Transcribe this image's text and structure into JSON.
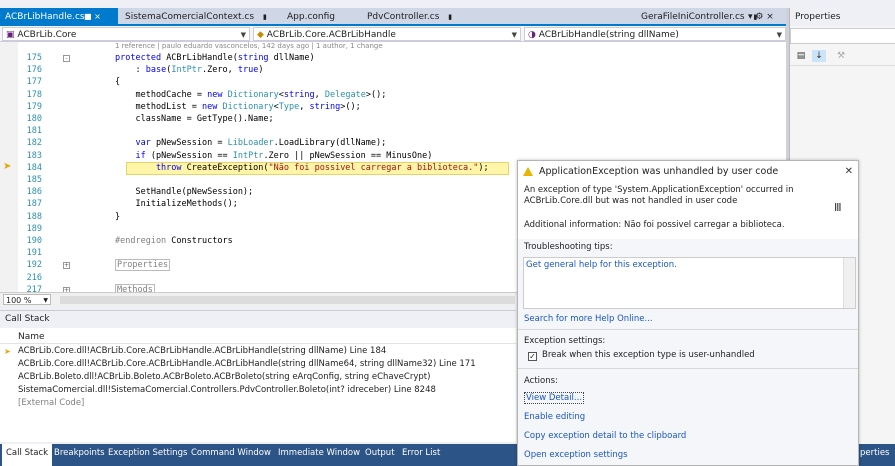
{
  "tabs": [
    {
      "label": "ACBrLibHandle.cs",
      "active": true,
      "controls": "■ ×"
    },
    {
      "label": "SistemaComercialContext.cs",
      "active": false
    },
    {
      "label": "App.config",
      "active": false
    },
    {
      "label": "PdvController.cs",
      "active": false
    },
    {
      "label": "GeraFileIniController.cs",
      "active": false
    }
  ],
  "tabbar_controls": "▾ ⚙ ×",
  "navbar": {
    "project": "ACBrLib.Core",
    "type": "ACBrLib.Core.ACBrLibHandle",
    "member": "ACBrLibHandle(string dllName)"
  },
  "code_lens": "1 reference | paulo eduardo vasconcelos, 142 days ago | 1 author, 1 change",
  "code": [
    {
      "ln": "175",
      "segs": [
        [
          "kw",
          "protected "
        ],
        [
          "",
          "ACBrLibHandle("
        ],
        [
          "kw",
          "string"
        ],
        [
          "",
          " dllName)"
        ]
      ]
    },
    {
      "ln": "176",
      "segs": [
        [
          "",
          "    : "
        ],
        [
          "kw",
          "base"
        ],
        [
          "",
          "("
        ],
        [
          "ty",
          "IntPtr"
        ],
        [
          "",
          ".Zero, "
        ],
        [
          "kw",
          "true"
        ],
        [
          "",
          ")"
        ]
      ]
    },
    {
      "ln": "177",
      "segs": [
        [
          "",
          "{"
        ]
      ]
    },
    {
      "ln": "178",
      "segs": [
        [
          "",
          "    methodCache = "
        ],
        [
          "kw",
          "new "
        ],
        [
          "ty",
          "Dictionary"
        ],
        [
          "",
          "<"
        ],
        [
          "kw",
          "string"
        ],
        [
          "",
          ", "
        ],
        [
          "ty",
          "Delegate"
        ],
        [
          "",
          ">();"
        ]
      ]
    },
    {
      "ln": "179",
      "segs": [
        [
          "",
          "    methodList = "
        ],
        [
          "kw",
          "new "
        ],
        [
          "ty",
          "Dictionary"
        ],
        [
          "",
          "<"
        ],
        [
          "ty",
          "Type"
        ],
        [
          "",
          ", "
        ],
        [
          "kw",
          "string"
        ],
        [
          "",
          ">();"
        ]
      ]
    },
    {
      "ln": "180",
      "segs": [
        [
          "",
          "    className = GetType().Name;"
        ]
      ]
    },
    {
      "ln": "181",
      "segs": [
        [
          "",
          ""
        ]
      ]
    },
    {
      "ln": "182",
      "segs": [
        [
          "kw",
          "    var "
        ],
        [
          "",
          "pNewSession = "
        ],
        [
          "ty",
          "LibLoader"
        ],
        [
          "",
          ".LoadLibrary(dllName);"
        ]
      ]
    },
    {
      "ln": "183",
      "segs": [
        [
          "kw",
          "    if "
        ],
        [
          "",
          "(pNewSession == "
        ],
        [
          "ty",
          "IntPtr"
        ],
        [
          "",
          ".Zero || pNewSession == MinusOne)"
        ]
      ]
    },
    {
      "ln": "184",
      "segs": [
        [
          "kw",
          "        throw "
        ],
        [
          "",
          "CreateException("
        ],
        [
          "st",
          "\"Não foi possivel carregar a biblioteca.\""
        ],
        [
          "",
          ");"
        ]
      ]
    },
    {
      "ln": "185",
      "segs": [
        [
          "",
          ""
        ]
      ]
    },
    {
      "ln": "186",
      "segs": [
        [
          "",
          "    SetHandle(pNewSession);"
        ]
      ]
    },
    {
      "ln": "187",
      "segs": [
        [
          "",
          "    InitializeMethods();"
        ]
      ]
    },
    {
      "ln": "188",
      "segs": [
        [
          "",
          "}"
        ]
      ]
    },
    {
      "ln": "189",
      "segs": [
        [
          "",
          ""
        ]
      ]
    },
    {
      "ln": "190",
      "segs": [
        [
          "gr",
          "#endregion "
        ],
        [
          "",
          "Constructors"
        ]
      ]
    },
    {
      "ln": "191",
      "segs": [
        [
          "",
          ""
        ]
      ]
    },
    {
      "ln": "192",
      "segs": [
        [
          "gr",
          "Properties"
        ]
      ]
    },
    {
      "ln": "216",
      "segs": [
        [
          "",
          ""
        ]
      ]
    },
    {
      "ln": "217",
      "segs": [
        [
          "gr",
          "Methods"
        ]
      ]
    }
  ],
  "zoom": "100 %",
  "call_stack": {
    "title": "Call Stack",
    "column": "Name",
    "rows": [
      "ACBrLib.Core.dll!ACBrLib.Core.ACBrLibHandle.ACBrLibHandle(string dllName) Line 184",
      "ACBrLib.Core.dll!ACBrLib.Core.ACBrLibHandle.ACBrLibHandle(string dllName64, string dllName32) Line 171",
      "ACBrLib.Boleto.dll!ACBrLib.Boleto.ACBrBoleto.ACBrBoleto(string eArqConfig, string eChaveCrypt)",
      "SistemaComercial.dll!SistemaComercial.Controllers.PdvController.Boleto(int? idreceber) Line 8248",
      "[External Code]"
    ]
  },
  "bottom_tabs": [
    "Call Stack",
    "Breakpoints",
    "Exception Settings",
    "Command Window",
    "Immediate Window",
    "Output",
    "Error List"
  ],
  "bottom_tabs_right": "perties",
  "properties": {
    "title": "Properties"
  },
  "exception": {
    "title": "ApplicationException was unhandled by user code",
    "message": "An exception of type 'System.ApplicationException' occurred in ACBrLib.Core.dll but was not handled in user code",
    "additional": "Additional information: Não foi possivel carregar a biblioteca.",
    "tips_heading": "Troubleshooting tips:",
    "tip_link": "Get general help for this exception.",
    "search_link": "Search for more Help Online...",
    "settings_heading": "Exception settings:",
    "checkbox_label": "Break when this exception type is user-unhandled",
    "actions_heading": "Actions:",
    "actions": [
      "View Detail...",
      "Enable editing",
      "Copy exception detail to the clipboard",
      "Open exception settings"
    ]
  },
  "colors": {
    "accent": "#007acc",
    "bottom_bar": "#2d5486",
    "warning": "#e8b400",
    "link": "#1a56c4"
  }
}
